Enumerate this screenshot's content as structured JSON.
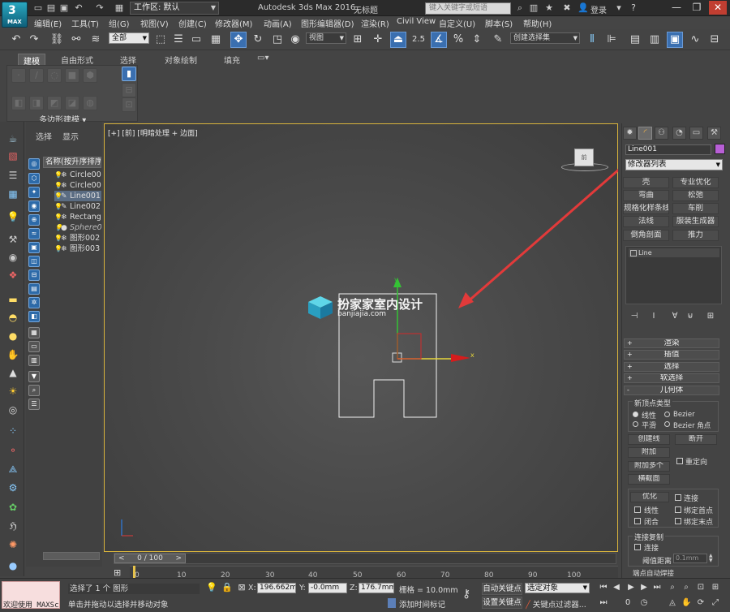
{
  "title_bar": {
    "app_logo_text": "MAX",
    "workspace_label": "工作区: 默认",
    "app_title": "Autodesk 3ds Max 2016",
    "doc_title": "无标题",
    "search_placeholder": "键入关键字或短语",
    "login_label": "登录"
  },
  "menus": [
    "编辑(E)",
    "工具(T)",
    "组(G)",
    "视图(V)",
    "创建(C)",
    "修改器(M)",
    "动画(A)",
    "图形编辑器(D)",
    "渲染(R)",
    "Civil View",
    "自定义(U)",
    "脚本(S)",
    "帮助(H)"
  ],
  "toolbar": {
    "selection_filter": "全部",
    "ref_coord": "视图",
    "angle_snap": "2.5",
    "named_selection": "创建选择集"
  },
  "ribbon": {
    "tabs": [
      "建模",
      "自由形式",
      "选择",
      "对象绘制",
      "填充"
    ],
    "panel_label": "多边形建模"
  },
  "explorer": {
    "tabs": [
      "选择",
      "显示"
    ],
    "header": "名称(按升序排序)",
    "items": [
      {
        "name": "Circle00",
        "state": "normal"
      },
      {
        "name": "Circle00",
        "state": "normal"
      },
      {
        "name": "Line001",
        "state": "selected"
      },
      {
        "name": "Line002",
        "state": "normal"
      },
      {
        "name": "Rectang",
        "state": "normal"
      },
      {
        "name": "Sphere0",
        "state": "dim"
      },
      {
        "name": "图形002",
        "state": "normal"
      },
      {
        "name": "图形003",
        "state": "normal"
      }
    ]
  },
  "viewport": {
    "label": "[+] [前] [明暗处理 + 边面]",
    "viewcube_face": "前",
    "watermark_title": "扮家家室内设计",
    "watermark_url": "banjiajia.com"
  },
  "timeline": {
    "frame": "0 / 100",
    "ticks": [
      "0",
      "10",
      "20",
      "30",
      "40",
      "50",
      "60",
      "70",
      "80",
      "90",
      "100"
    ]
  },
  "command_panel": {
    "object_name": "Line001",
    "object_color": "#b85fd6",
    "modifier_list": "修改器列表",
    "modifier_buttons": [
      "壳",
      "专业优化",
      "弯曲",
      "松弛",
      "规格化样条线",
      "车削",
      "法线",
      "服装生成器",
      "倒角剖面",
      "推力"
    ],
    "stack_item": "Line",
    "rollouts": [
      "渲染",
      "插值",
      "选择",
      "软选择",
      "几何体"
    ],
    "new_vertex_type": "新顶点类型",
    "vertex_options": [
      "线性",
      "Bezier",
      "平滑",
      "Bezier 角点"
    ],
    "create_line": "创建线",
    "break": "断开",
    "attach": "附加",
    "reorient": "重定向",
    "attach_multiple": "附加多个",
    "cross_section": "横截面",
    "optimize": "优化",
    "connect": "连接",
    "linear": "线性",
    "bind_first": "绑定首点",
    "closed": "闭合",
    "bind_last": "绑定末点",
    "connect_copy": "连接复制",
    "connect2": "连接",
    "threshold_label": "阈值距离",
    "threshold_value": "0.1mm",
    "endpoint_weld": "端点自动焊接"
  },
  "status": {
    "maxscript": "欢迎使用 MAXSc",
    "selected": "选择了 1 个 图形",
    "prompt": "单击并拖动以选择并移动对象",
    "x_label": "X:",
    "x_value": "196.662mm",
    "y_label": "Y:",
    "y_value": "-0.0mm",
    "z_label": "Z:",
    "z_value": "176.7mm",
    "grid": "栅格 = 10.0mm",
    "add_time_tag": "添加时间标记",
    "auto_key": "自动关键点",
    "set_key": "设置关键点",
    "selection_set": "选定对象",
    "key_filter": "关键点过滤器..."
  }
}
